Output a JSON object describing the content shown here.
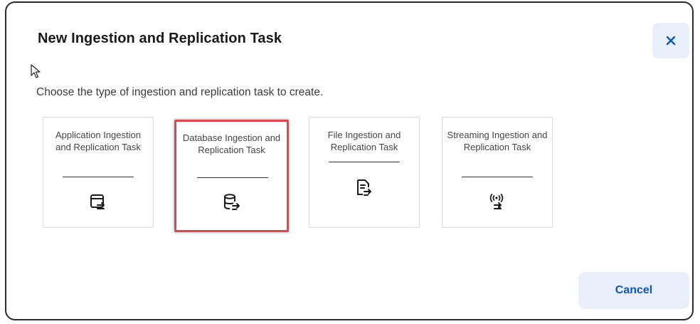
{
  "dialog": {
    "title": "New Ingestion and Replication Task",
    "subtitle": "Choose the type of ingestion and replication task to create.",
    "cancel_label": "Cancel",
    "close_icon": "close-icon"
  },
  "cards": [
    {
      "label": "Application Ingestion and Replication Task",
      "icon": "application-ingestion-icon",
      "selected": false
    },
    {
      "label": "Database Ingestion and Replication Task",
      "icon": "database-ingestion-icon",
      "selected": true
    },
    {
      "label": "File Ingestion and Replication Task",
      "icon": "file-ingestion-icon",
      "selected": false
    },
    {
      "label": "Streaming Ingestion and Replication Task",
      "icon": "streaming-ingestion-icon",
      "selected": false
    }
  ],
  "colors": {
    "accent": "#0b56b8",
    "button_bg": "#e9effa",
    "selection_border": "#e0474c",
    "text": "#1a1a1a"
  }
}
